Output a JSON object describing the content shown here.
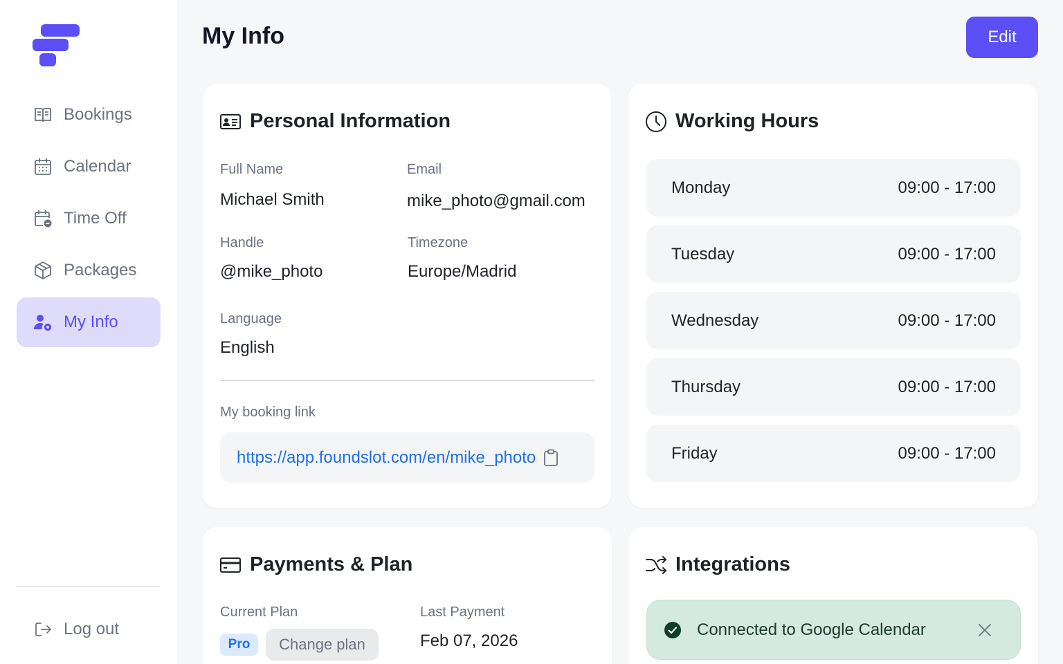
{
  "sidebar": {
    "items": [
      {
        "label": "Bookings",
        "icon": "book-open-icon"
      },
      {
        "label": "Calendar",
        "icon": "calendar-icon"
      },
      {
        "label": "Time Off",
        "icon": "calendar-minus-icon"
      },
      {
        "label": "Packages",
        "icon": "package-icon"
      },
      {
        "label": "My Info",
        "icon": "user-cog-icon",
        "active": true
      }
    ],
    "logout_label": "Log out"
  },
  "header": {
    "title": "My Info",
    "edit_label": "Edit"
  },
  "personal": {
    "title": "Personal Information",
    "full_name_label": "Full Name",
    "full_name": "Michael Smith",
    "email_label": "Email",
    "email": "mike_photo@gmail.com",
    "handle_label": "Handle",
    "handle": "@mike_photo",
    "timezone_label": "Timezone",
    "timezone": "Europe/Madrid",
    "language_label": "Language",
    "language": "English",
    "booking_link_label": "My booking link",
    "booking_link": "https://app.foundslot.com/en/mike_photo"
  },
  "working_hours": {
    "title": "Working Hours",
    "days": [
      {
        "day": "Monday",
        "hours": "09:00 - 17:00"
      },
      {
        "day": "Tuesday",
        "hours": "09:00 - 17:00"
      },
      {
        "day": "Wednesday",
        "hours": "09:00 - 17:00"
      },
      {
        "day": "Thursday",
        "hours": "09:00 - 17:00"
      },
      {
        "day": "Friday",
        "hours": "09:00 - 17:00"
      }
    ]
  },
  "payments": {
    "title": "Payments & Plan",
    "current_plan_label": "Current Plan",
    "plan_badge": "Pro",
    "change_plan_label": "Change plan",
    "last_payment_label": "Last Payment",
    "last_payment": "Feb 07, 2026"
  },
  "integrations": {
    "title": "Integrations",
    "google_status": "Connected to Google Calendar"
  },
  "colors": {
    "accent": "#5b4ff5",
    "active_nav_bg": "#dfdbfb",
    "link": "#1f6feb",
    "success_bg": "#d4e9df"
  }
}
